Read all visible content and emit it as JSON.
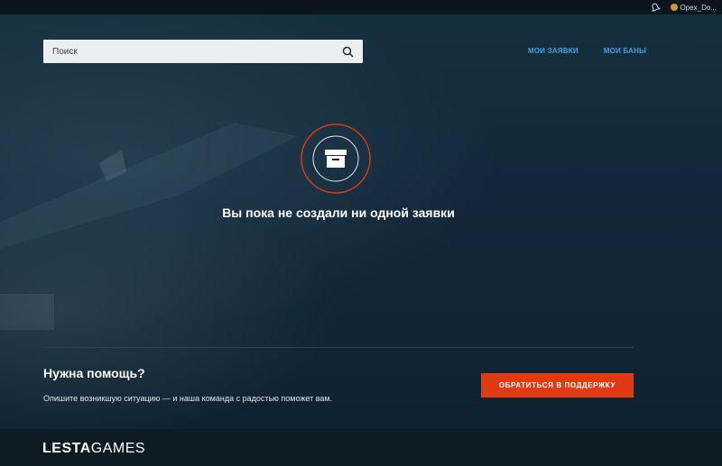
{
  "topbar": {
    "user_name": "Opex_Do...",
    "bell_icon": "bell-icon",
    "coin_icon": "coin-icon"
  },
  "search": {
    "placeholder": "Поиск",
    "icon": "search-icon"
  },
  "nav": {
    "my_requests": "МОИ ЗАЯВКИ",
    "my_bans": "МОИ БАНЫ"
  },
  "empty_state": {
    "icon": "inbox-box-icon",
    "message": "Вы пока не создали ни одной заявки"
  },
  "help": {
    "title": "Нужна помощь?",
    "description": "Опишите возникшую ситуацию — и наша команда с радостью поможет вам.",
    "button_label": "ОБРАТИТЬСЯ В ПОДДЕРЖКУ"
  },
  "footer": {
    "logo_part1": "LESTA",
    "logo_part2": "GAMES"
  },
  "colors": {
    "accent_orange": "#e03a12",
    "link_blue": "#3fa3e6",
    "background": "#11232e"
  }
}
